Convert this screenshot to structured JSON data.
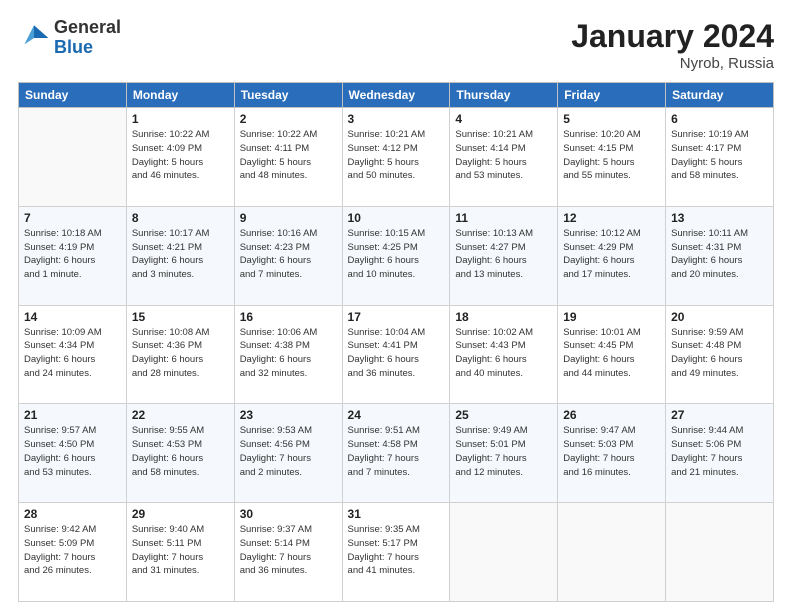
{
  "header": {
    "logo_general": "General",
    "logo_blue": "Blue",
    "month_title": "January 2024",
    "location": "Nyrob, Russia"
  },
  "weekdays": [
    "Sunday",
    "Monday",
    "Tuesday",
    "Wednesday",
    "Thursday",
    "Friday",
    "Saturday"
  ],
  "weeks": [
    [
      {
        "day": "",
        "info": ""
      },
      {
        "day": "1",
        "info": "Sunrise: 10:22 AM\nSunset: 4:09 PM\nDaylight: 5 hours\nand 46 minutes."
      },
      {
        "day": "2",
        "info": "Sunrise: 10:22 AM\nSunset: 4:11 PM\nDaylight: 5 hours\nand 48 minutes."
      },
      {
        "day": "3",
        "info": "Sunrise: 10:21 AM\nSunset: 4:12 PM\nDaylight: 5 hours\nand 50 minutes."
      },
      {
        "day": "4",
        "info": "Sunrise: 10:21 AM\nSunset: 4:14 PM\nDaylight: 5 hours\nand 53 minutes."
      },
      {
        "day": "5",
        "info": "Sunrise: 10:20 AM\nSunset: 4:15 PM\nDaylight: 5 hours\nand 55 minutes."
      },
      {
        "day": "6",
        "info": "Sunrise: 10:19 AM\nSunset: 4:17 PM\nDaylight: 5 hours\nand 58 minutes."
      }
    ],
    [
      {
        "day": "7",
        "info": "Sunrise: 10:18 AM\nSunset: 4:19 PM\nDaylight: 6 hours\nand 1 minute."
      },
      {
        "day": "8",
        "info": "Sunrise: 10:17 AM\nSunset: 4:21 PM\nDaylight: 6 hours\nand 3 minutes."
      },
      {
        "day": "9",
        "info": "Sunrise: 10:16 AM\nSunset: 4:23 PM\nDaylight: 6 hours\nand 7 minutes."
      },
      {
        "day": "10",
        "info": "Sunrise: 10:15 AM\nSunset: 4:25 PM\nDaylight: 6 hours\nand 10 minutes."
      },
      {
        "day": "11",
        "info": "Sunrise: 10:13 AM\nSunset: 4:27 PM\nDaylight: 6 hours\nand 13 minutes."
      },
      {
        "day": "12",
        "info": "Sunrise: 10:12 AM\nSunset: 4:29 PM\nDaylight: 6 hours\nand 17 minutes."
      },
      {
        "day": "13",
        "info": "Sunrise: 10:11 AM\nSunset: 4:31 PM\nDaylight: 6 hours\nand 20 minutes."
      }
    ],
    [
      {
        "day": "14",
        "info": "Sunrise: 10:09 AM\nSunset: 4:34 PM\nDaylight: 6 hours\nand 24 minutes."
      },
      {
        "day": "15",
        "info": "Sunrise: 10:08 AM\nSunset: 4:36 PM\nDaylight: 6 hours\nand 28 minutes."
      },
      {
        "day": "16",
        "info": "Sunrise: 10:06 AM\nSunset: 4:38 PM\nDaylight: 6 hours\nand 32 minutes."
      },
      {
        "day": "17",
        "info": "Sunrise: 10:04 AM\nSunset: 4:41 PM\nDaylight: 6 hours\nand 36 minutes."
      },
      {
        "day": "18",
        "info": "Sunrise: 10:02 AM\nSunset: 4:43 PM\nDaylight: 6 hours\nand 40 minutes."
      },
      {
        "day": "19",
        "info": "Sunrise: 10:01 AM\nSunset: 4:45 PM\nDaylight: 6 hours\nand 44 minutes."
      },
      {
        "day": "20",
        "info": "Sunrise: 9:59 AM\nSunset: 4:48 PM\nDaylight: 6 hours\nand 49 minutes."
      }
    ],
    [
      {
        "day": "21",
        "info": "Sunrise: 9:57 AM\nSunset: 4:50 PM\nDaylight: 6 hours\nand 53 minutes."
      },
      {
        "day": "22",
        "info": "Sunrise: 9:55 AM\nSunset: 4:53 PM\nDaylight: 6 hours\nand 58 minutes."
      },
      {
        "day": "23",
        "info": "Sunrise: 9:53 AM\nSunset: 4:56 PM\nDaylight: 7 hours\nand 2 minutes."
      },
      {
        "day": "24",
        "info": "Sunrise: 9:51 AM\nSunset: 4:58 PM\nDaylight: 7 hours\nand 7 minutes."
      },
      {
        "day": "25",
        "info": "Sunrise: 9:49 AM\nSunset: 5:01 PM\nDaylight: 7 hours\nand 12 minutes."
      },
      {
        "day": "26",
        "info": "Sunrise: 9:47 AM\nSunset: 5:03 PM\nDaylight: 7 hours\nand 16 minutes."
      },
      {
        "day": "27",
        "info": "Sunrise: 9:44 AM\nSunset: 5:06 PM\nDaylight: 7 hours\nand 21 minutes."
      }
    ],
    [
      {
        "day": "28",
        "info": "Sunrise: 9:42 AM\nSunset: 5:09 PM\nDaylight: 7 hours\nand 26 minutes."
      },
      {
        "day": "29",
        "info": "Sunrise: 9:40 AM\nSunset: 5:11 PM\nDaylight: 7 hours\nand 31 minutes."
      },
      {
        "day": "30",
        "info": "Sunrise: 9:37 AM\nSunset: 5:14 PM\nDaylight: 7 hours\nand 36 minutes."
      },
      {
        "day": "31",
        "info": "Sunrise: 9:35 AM\nSunset: 5:17 PM\nDaylight: 7 hours\nand 41 minutes."
      },
      {
        "day": "",
        "info": ""
      },
      {
        "day": "",
        "info": ""
      },
      {
        "day": "",
        "info": ""
      }
    ]
  ]
}
